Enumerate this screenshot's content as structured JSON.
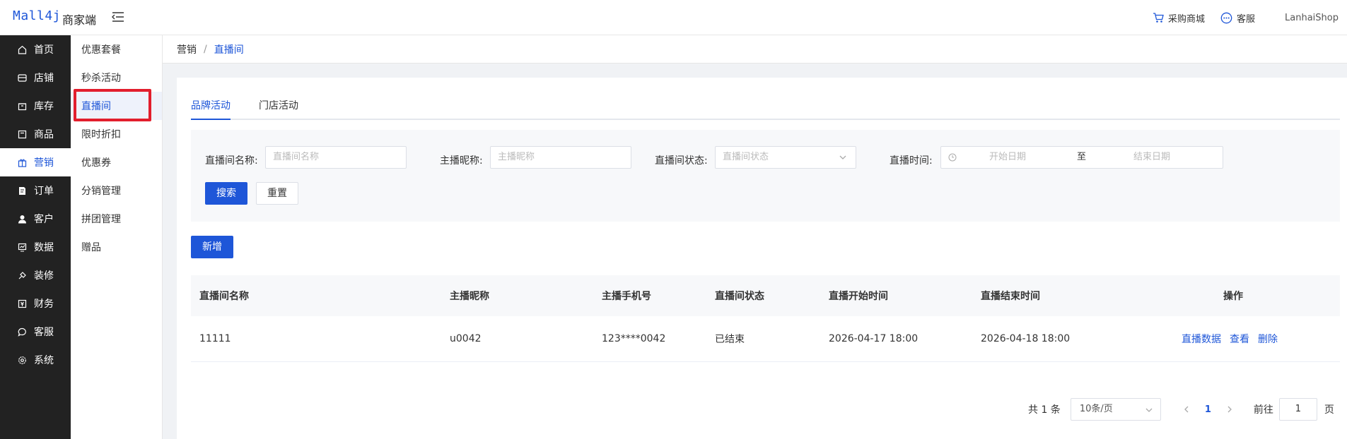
{
  "header": {
    "logo": "Mall4j",
    "subtitle": "商家端",
    "links": [
      {
        "label": "采购商城",
        "icon": "cart-icon"
      },
      {
        "label": "客服",
        "icon": "chat-icon"
      }
    ],
    "user": "LanhaiShop"
  },
  "leftnav": [
    {
      "label": "首页",
      "icon": "home-icon"
    },
    {
      "label": "店铺",
      "icon": "store-icon"
    },
    {
      "label": "库存",
      "icon": "box-icon"
    },
    {
      "label": "商品",
      "icon": "goods-icon"
    },
    {
      "label": "营销",
      "icon": "gift-icon",
      "active": true
    },
    {
      "label": "订单",
      "icon": "order-icon"
    },
    {
      "label": "客户",
      "icon": "user-icon"
    },
    {
      "label": "数据",
      "icon": "chart-icon"
    },
    {
      "label": "装修",
      "icon": "brush-icon"
    },
    {
      "label": "财务",
      "icon": "finance-icon"
    },
    {
      "label": "客服",
      "icon": "chat-icon"
    },
    {
      "label": "系统",
      "icon": "settings-icon"
    }
  ],
  "subnav": [
    {
      "label": "优惠套餐"
    },
    {
      "label": "秒杀活动"
    },
    {
      "label": "直播间",
      "active": true
    },
    {
      "label": "限时折扣"
    },
    {
      "label": "优惠券"
    },
    {
      "label": "分销管理"
    },
    {
      "label": "拼团管理"
    },
    {
      "label": "赠品"
    }
  ],
  "breadcrumb": {
    "parent": "营销",
    "sep": "/",
    "current": "直播间"
  },
  "tabs": [
    {
      "label": "品牌活动",
      "active": true
    },
    {
      "label": "门店活动"
    }
  ],
  "filter": {
    "room_name_label": "直播间名称:",
    "room_name_placeholder": "直播间名称",
    "anchor_label": "主播昵称:",
    "anchor_placeholder": "主播昵称",
    "status_label": "直播间状态:",
    "status_placeholder": "直播间状态",
    "time_label": "直播时间:",
    "start_placeholder": "开始日期",
    "range_sep": "至",
    "end_placeholder": "结束日期",
    "search_label": "搜索",
    "reset_label": "重置"
  },
  "add_label": "新增",
  "table": {
    "columns": [
      "直播间名称",
      "主播昵称",
      "主播手机号",
      "直播间状态",
      "直播开始时间",
      "直播结束时间",
      "操作"
    ],
    "rows": [
      {
        "name": "11111",
        "anchor": "u0042",
        "phone": "123****0042",
        "status": "已结束",
        "start": "2026-04-17 18:00",
        "end": "2026-04-18 18:00",
        "ops": [
          "直播数据",
          "查看",
          "删除"
        ]
      }
    ]
  },
  "pagination": {
    "total": "共 1 条",
    "page_size": "10条/页",
    "current_page": "1",
    "goto_label": "前往",
    "goto_value": "1",
    "page_suffix": "页"
  },
  "colors": {
    "accent": "#1e56d8",
    "nav_bg": "#222222",
    "highlight": "#e21e2d"
  }
}
